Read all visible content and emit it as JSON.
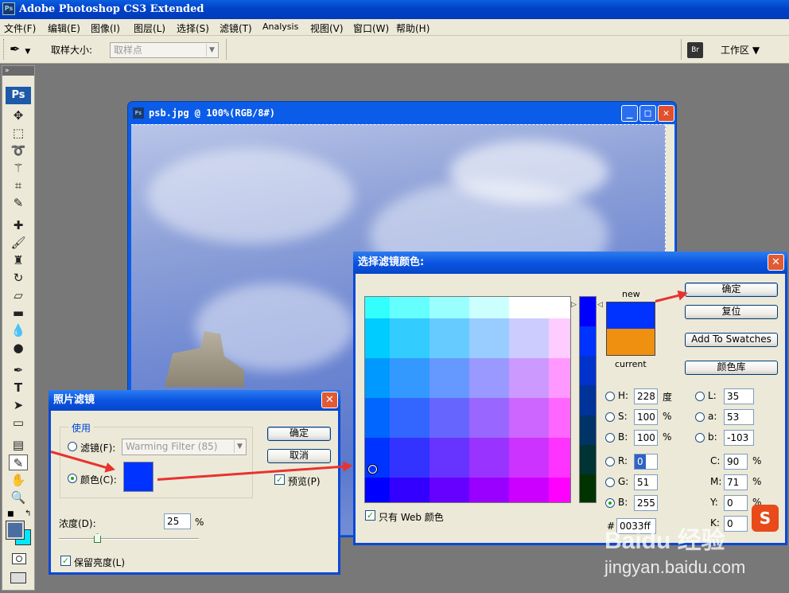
{
  "app": {
    "title": "Adobe Photoshop CS3 Extended",
    "logo": "Ps"
  },
  "menu": [
    "文件(F)",
    "编辑(E)",
    "图像(I)",
    "图层(L)",
    "选择(S)",
    "滤镜(T)",
    "Analysis",
    "视图(V)",
    "窗口(W)",
    "帮助(H)"
  ],
  "options": {
    "sample_size_label": "取样大小:",
    "sample_size_value": "取样点",
    "bridge_label": "Br",
    "workspace_label": "工作区 ▼"
  },
  "toolbox": {
    "logo": "Ps"
  },
  "document": {
    "title": "psb.jpg @ 100%(RGB/8#)",
    "icon": "Ps"
  },
  "photo_filter": {
    "title": "照片滤镜",
    "group_label": "使用",
    "filter_label": "滤镜(F):",
    "filter_value": "Warming Filter (85)",
    "color_label": "颜色(C):",
    "color_swatch": "#0033ff",
    "ok": "确定",
    "cancel": "取消",
    "preview_label": "预览(P)",
    "preview_checked": true,
    "density_label": "浓度(D):",
    "density_value": "25",
    "density_unit": "%",
    "density_fraction": 0.25,
    "preserve_label": "保留亮度(L)",
    "preserve_checked": true
  },
  "color_picker": {
    "title": "选择滤镜颜色:",
    "new_label": "new",
    "current_label": "current",
    "new_color": "#0033ff",
    "current_color": "#f09010",
    "ok": "确定",
    "reset": "复位",
    "add_swatches": "Add To Swatches",
    "color_libraries": "颜色库",
    "web_only_label": "只有 Web 颜色",
    "web_only_checked": true,
    "hsb": [
      {
        "k": "H:",
        "v": "228",
        "u": "度"
      },
      {
        "k": "S:",
        "v": "100",
        "u": "%"
      },
      {
        "k": "B:",
        "v": "100",
        "u": "%"
      }
    ],
    "rgb": [
      {
        "k": "R:",
        "v": "0"
      },
      {
        "k": "G:",
        "v": "51"
      },
      {
        "k": "B:",
        "v": "255"
      }
    ],
    "lab": [
      {
        "k": "L:",
        "v": "35"
      },
      {
        "k": "a:",
        "v": "53"
      },
      {
        "k": "b:",
        "v": "-103"
      }
    ],
    "cmyk": [
      {
        "k": "C:",
        "v": "90",
        "u": "%"
      },
      {
        "k": "M:",
        "v": "71",
        "u": "%"
      },
      {
        "k": "Y:",
        "v": "0",
        "u": "%"
      },
      {
        "k": "K:",
        "v": "0",
        "u": "%"
      }
    ],
    "hex_label": "#",
    "hex_value": "0033ff",
    "grid_colors": [
      [
        "#33ffff",
        "#66ffff",
        "#99ffff",
        "#ccffff",
        "#ffffff",
        "#ffffff"
      ],
      [
        "#00ccff",
        "#33ccff",
        "#66ccff",
        "#99ccff",
        "#ccccff",
        "#ffccff"
      ],
      [
        "#0099ff",
        "#3399ff",
        "#6699ff",
        "#9999ff",
        "#cc99ff",
        "#ff99ff"
      ],
      [
        "#0066ff",
        "#3366ff",
        "#6666ff",
        "#9966ff",
        "#cc66ff",
        "#ff66ff"
      ],
      [
        "#0033ff",
        "#3333ff",
        "#6633ff",
        "#9933ff",
        "#cc33ff",
        "#ff33ff"
      ],
      [
        "#0000ff",
        "#3300ff",
        "#6600ff",
        "#9900ff",
        "#cc00ff",
        "#ff00ff"
      ]
    ],
    "slider_colors": [
      "#0000ff",
      "#0033ff",
      "#0033cc",
      "#003399",
      "#003366",
      "#003333",
      "#003300"
    ]
  },
  "watermark": {
    "brand": "Baidu 经验",
    "url": "jingyan.baidu.com"
  }
}
